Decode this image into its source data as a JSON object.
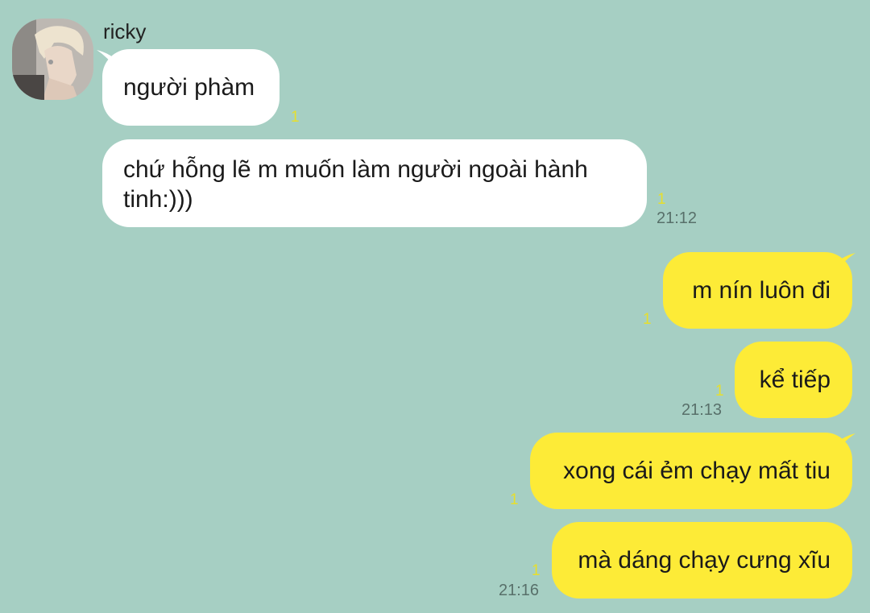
{
  "contact": {
    "name": "ricky"
  },
  "colors": {
    "background": "#a6cfc3",
    "incoming_bubble": "#ffffff",
    "outgoing_bubble": "#fdeb37",
    "read_marker": "#e7df2c",
    "timestamp": "#58706a"
  },
  "messages": [
    {
      "direction": "incoming",
      "text": "người phàm",
      "read": "1",
      "time": ""
    },
    {
      "direction": "incoming",
      "text": "chứ hỗng lẽ m muốn làm người ngoài hành tinh:)))",
      "read": "1",
      "time": "21:12"
    },
    {
      "direction": "outgoing",
      "text": "m nín luôn đi",
      "read": "1",
      "time": ""
    },
    {
      "direction": "outgoing",
      "text": "kể tiếp",
      "read": "1",
      "time": "21:13"
    },
    {
      "direction": "outgoing",
      "text": "xong cái ẻm chạy mất tiu",
      "read": "1",
      "time": ""
    },
    {
      "direction": "outgoing",
      "text": "mà dáng chạy cưng xĩu",
      "read": "1",
      "time": "21:16"
    }
  ]
}
